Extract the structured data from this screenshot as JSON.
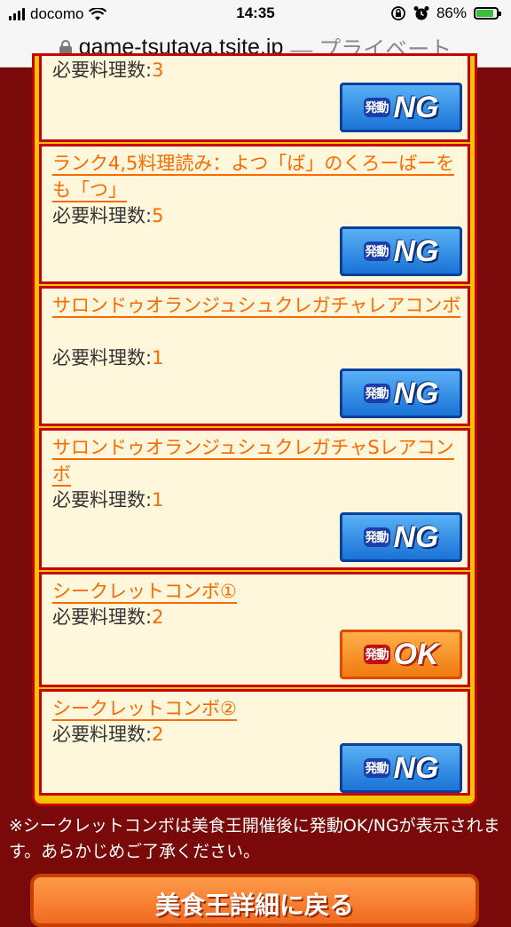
{
  "status_bar": {
    "carrier": "docomo",
    "time": "14:35",
    "battery": "86%"
  },
  "url_bar": {
    "domain": "game-tsutaya.tsite.jp",
    "mode": "— プライベート"
  },
  "cards": [
    {
      "title": "",
      "req_label": "必要料理数:",
      "req_value": "3",
      "status": "NG"
    },
    {
      "title": "ランク4,5料理読み：よつ「ば」のくろーばーをも「つ」",
      "req_label": "必要料理数:",
      "req_value": "5",
      "status": "NG"
    },
    {
      "title": "サロンドゥオランジュシュクレガチャレアコンボ",
      "req_label": "必要料理数:",
      "req_value": "1",
      "status": "NG"
    },
    {
      "title": "サロンドゥオランジュシュクレガチャSレアコンボ",
      "req_label": "必要料理数:",
      "req_value": "1",
      "status": "NG"
    },
    {
      "title": "シークレットコンボ①",
      "req_label": "必要料理数:",
      "req_value": "2",
      "status": "OK"
    },
    {
      "title": "シークレットコンボ②",
      "req_label": "必要料理数:",
      "req_value": "2",
      "status": "NG"
    }
  ],
  "badge_prefix": "発動",
  "note": "※シークレットコンボは美食王開催後に発動OK/NGが表示されます。あらかじめご了承ください。",
  "back_button": "美食王詳細に戻る",
  "icons": [
    "signal-icon",
    "wifi-icon",
    "lock-icon",
    "alarm-icon",
    "battery-icon"
  ]
}
